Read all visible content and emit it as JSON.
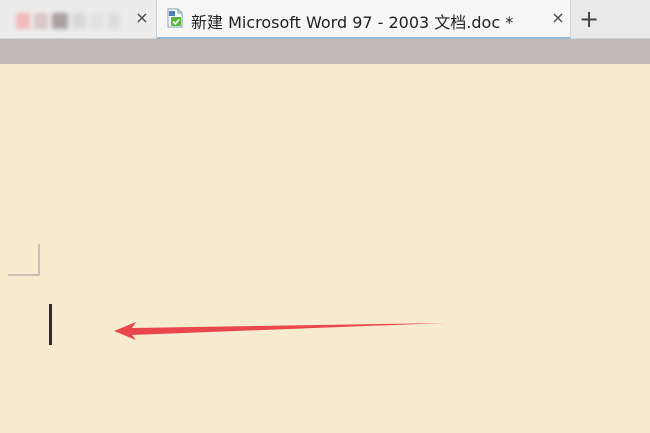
{
  "tabs": [
    {
      "label": "",
      "active": false,
      "close_label": "×"
    },
    {
      "label": "新建 Microsoft Word 97 - 2003 文档.doc *",
      "active": true,
      "close_label": "×",
      "icon": "word-doc-icon"
    }
  ],
  "new_tab_label": "+",
  "colors": {
    "page_background": "#f8ebcf",
    "toolbar_strip": "#bebab3",
    "annotation_arrow": "#e8474e",
    "active_tab_underline": "#8fb6d6"
  }
}
